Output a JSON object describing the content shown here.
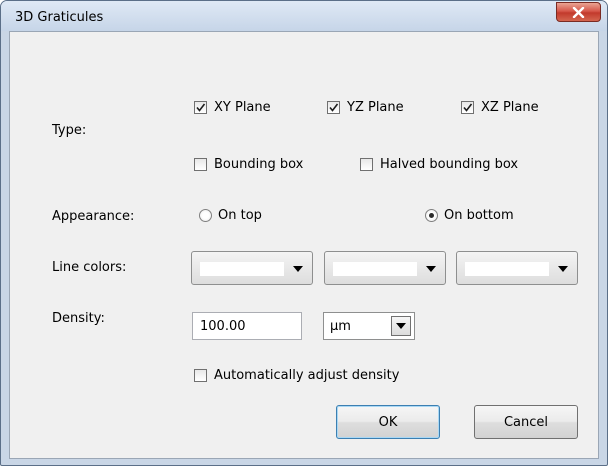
{
  "window": {
    "title": "3D Graticules",
    "close_icon": "close-icon"
  },
  "type": {
    "label": "Type:",
    "options": [
      {
        "label": "XY Plane",
        "checked": true
      },
      {
        "label": "YZ Plane",
        "checked": true
      },
      {
        "label": "XZ Plane",
        "checked": true
      },
      {
        "label": "Bounding box",
        "checked": false
      },
      {
        "label": "Halved bounding box",
        "checked": false
      }
    ]
  },
  "appearance": {
    "label": "Appearance:",
    "options": [
      {
        "label": "On top",
        "selected": false
      },
      {
        "label": "On bottom",
        "selected": true
      }
    ]
  },
  "line_colors": {
    "label": "Line colors:",
    "colors": [
      "#ffffff",
      "#ffffff",
      "#ffffff"
    ]
  },
  "density": {
    "label": "Density:",
    "value": "100.00",
    "unit": "µm",
    "auto_adjust": {
      "label": "Automatically adjust density",
      "checked": false
    }
  },
  "buttons": {
    "ok": "OK",
    "cancel": "Cancel"
  }
}
